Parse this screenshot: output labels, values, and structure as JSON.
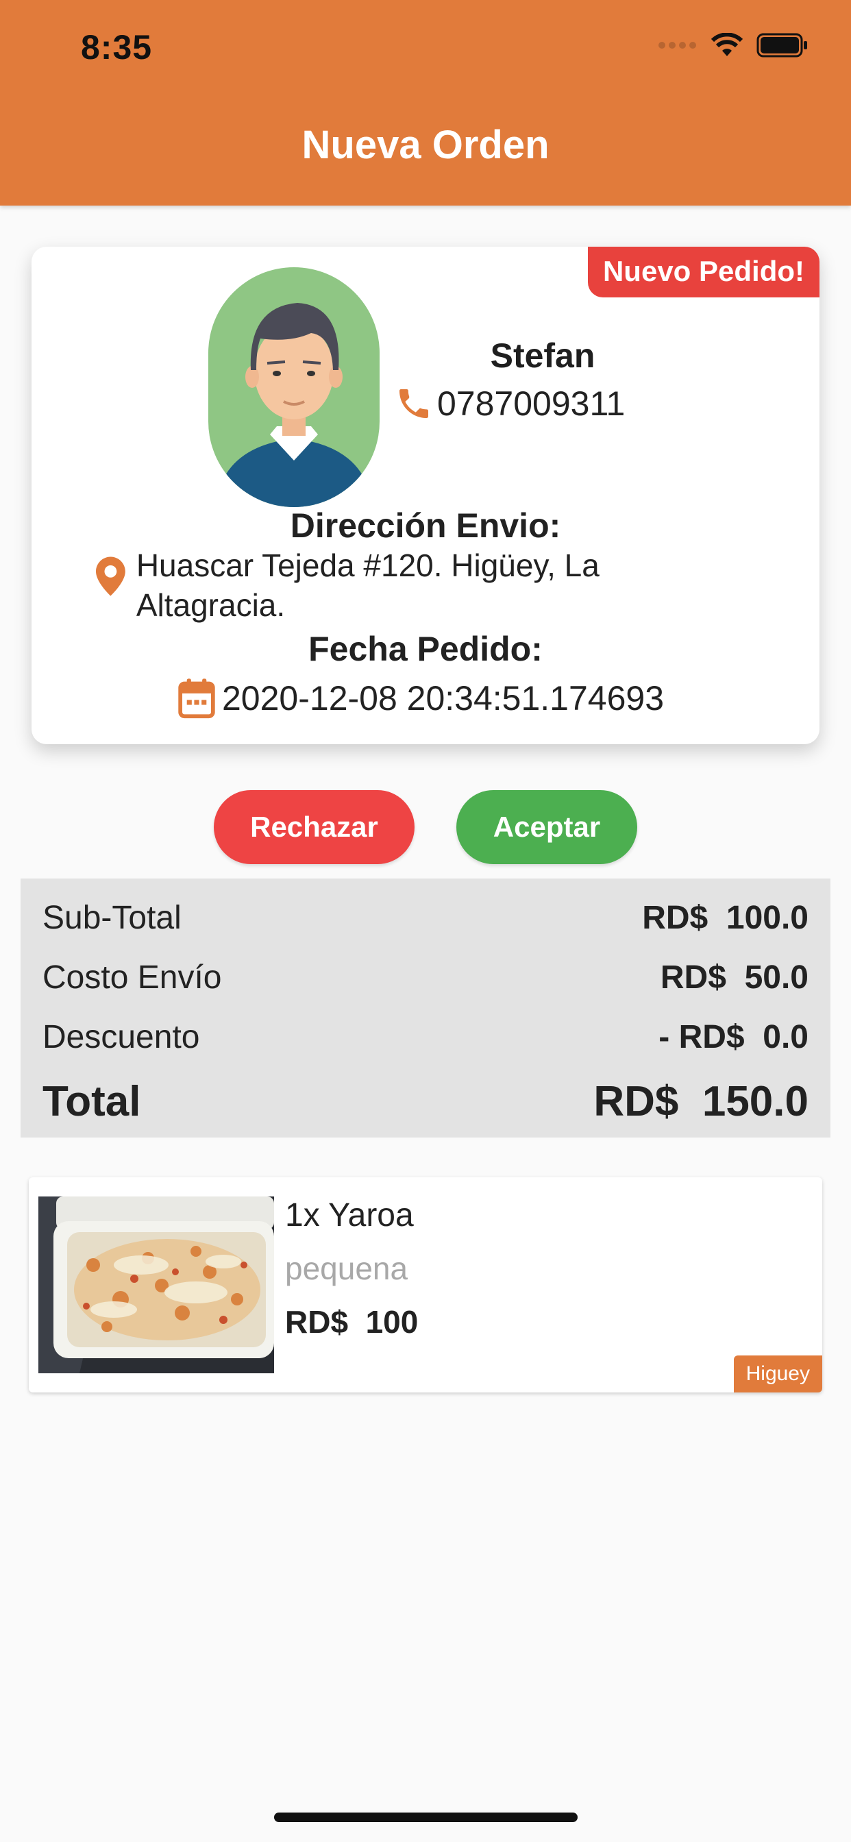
{
  "status_bar": {
    "time": "8:35"
  },
  "header": {
    "title": "Nueva Orden"
  },
  "order_card": {
    "badge": "Nuevo Pedido!",
    "customer_name": "Stefan",
    "phone": "0787009311",
    "address_label": "Dirección Envio:",
    "address": "Huascar Tejeda #120. Higüey, La Altagracia.",
    "date_label": "Fecha Pedido:",
    "date": "2020-12-08 20:34:51.174693"
  },
  "actions": {
    "reject": "Rechazar",
    "accept": "Aceptar"
  },
  "summary": {
    "subtotal_label": "Sub-Total",
    "subtotal_value": "RD$  100.0",
    "shipping_label": "Costo Envío",
    "shipping_value": "RD$  50.0",
    "discount_label": "Descuento",
    "discount_value": "- RD$  0.0",
    "total_label": "Total",
    "total_value": "RD$  150.0"
  },
  "items": [
    {
      "name": "1x Yaroa",
      "size": "pequena",
      "price": "RD$  100",
      "tag": "Higuey"
    }
  ],
  "colors": {
    "brand": "#e17b3b",
    "reject": "#ee4444",
    "accept": "#4caf50",
    "badge": "#e8423d"
  },
  "icons": [
    "wifi-icon",
    "battery-icon",
    "cellular-icon",
    "phone-icon",
    "location-pin-icon",
    "calendar-icon"
  ]
}
